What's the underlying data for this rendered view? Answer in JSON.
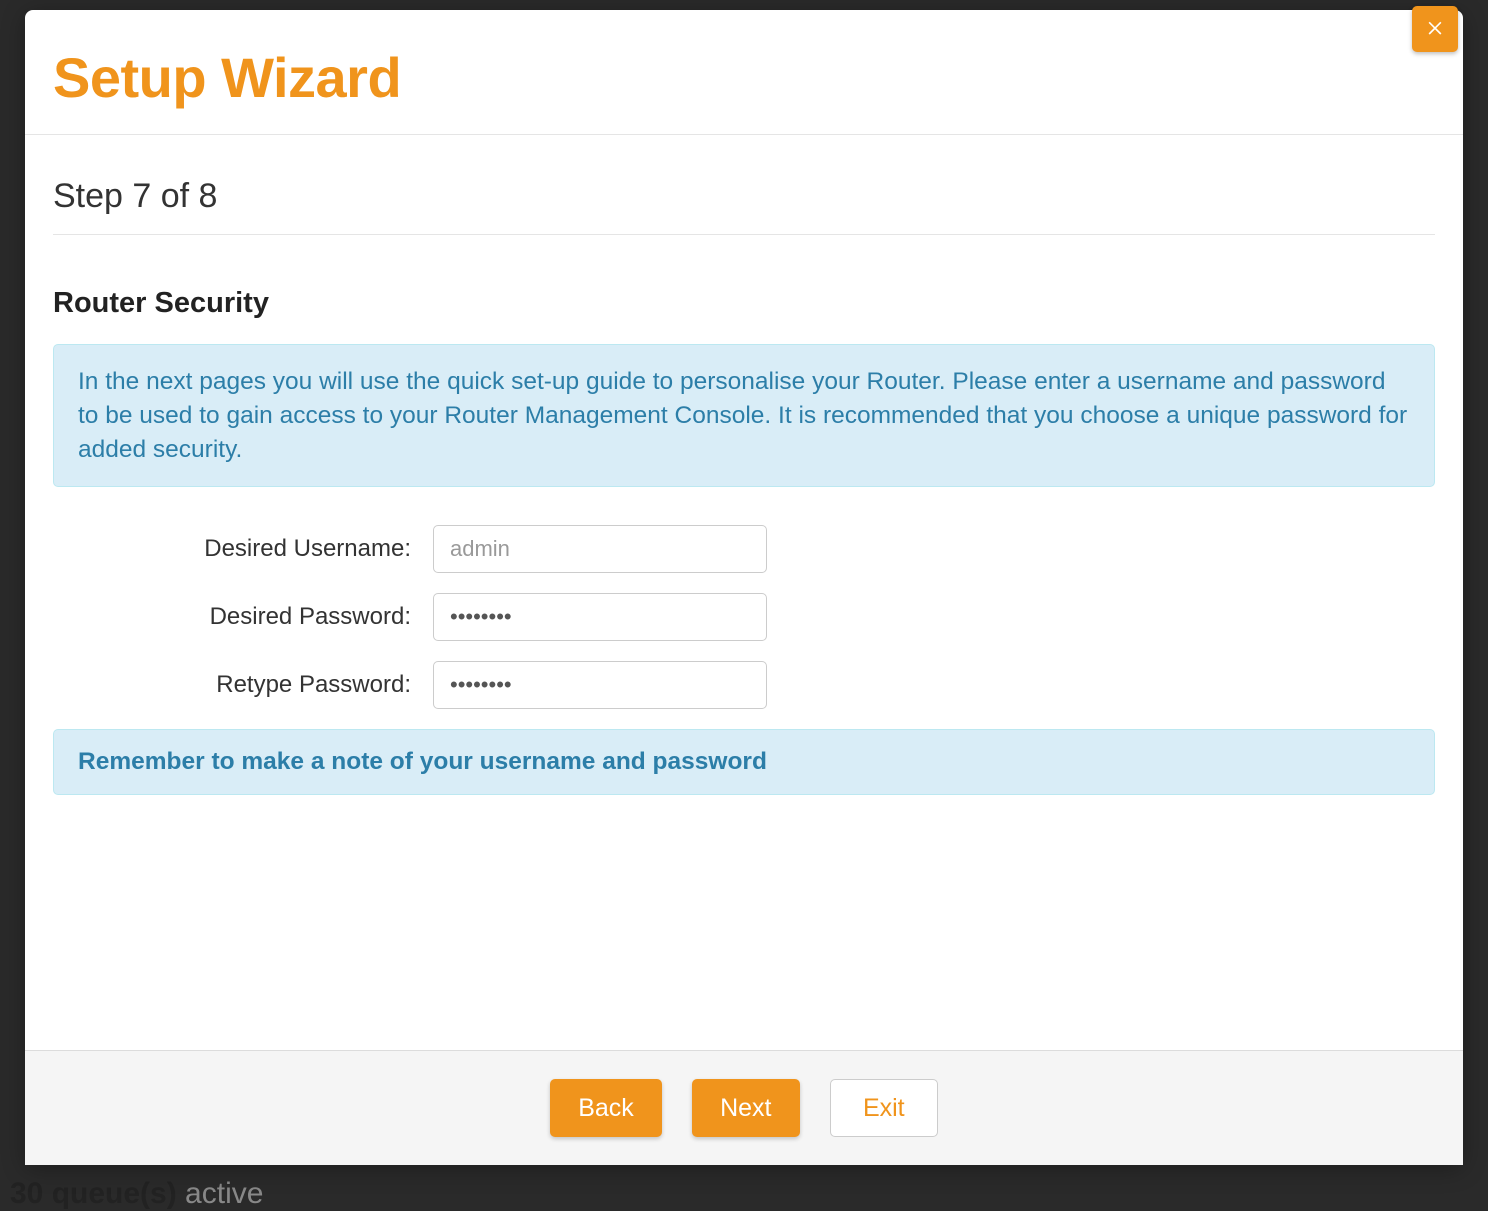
{
  "modal": {
    "title": "Setup Wizard",
    "step_indicator": "Step 7 of 8",
    "section_title": "Router Security",
    "info_text": "In the next pages you will use the quick set-up guide to personalise your Router. Please enter a username and password to be used to gain access to your Router Management Console. It is recommended that you choose a unique password for added security.",
    "reminder_text": "Remember to make a note of your username and password",
    "form": {
      "username_label": "Desired Username:",
      "username_placeholder": "admin",
      "username_value": "",
      "password_label": "Desired Password:",
      "password_value": "••••••••",
      "retype_label": "Retype Password:",
      "retype_value": "••••••••"
    },
    "buttons": {
      "back": "Back",
      "next": "Next",
      "exit": "Exit"
    }
  },
  "background": {
    "queues_count": "30 queue(s)",
    "queues_state": " active"
  }
}
